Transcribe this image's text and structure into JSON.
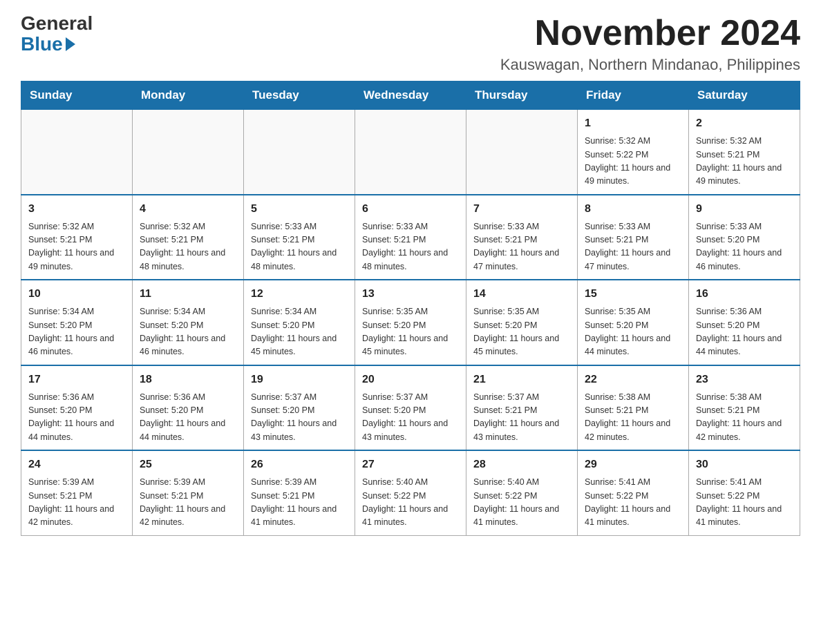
{
  "header": {
    "logo_general": "General",
    "logo_blue": "Blue",
    "month_title": "November 2024",
    "location": "Kauswagan, Northern Mindanao, Philippines"
  },
  "weekdays": [
    "Sunday",
    "Monday",
    "Tuesday",
    "Wednesday",
    "Thursday",
    "Friday",
    "Saturday"
  ],
  "weeks": [
    [
      {
        "day": "",
        "info": ""
      },
      {
        "day": "",
        "info": ""
      },
      {
        "day": "",
        "info": ""
      },
      {
        "day": "",
        "info": ""
      },
      {
        "day": "",
        "info": ""
      },
      {
        "day": "1",
        "info": "Sunrise: 5:32 AM\nSunset: 5:22 PM\nDaylight: 11 hours and 49 minutes."
      },
      {
        "day": "2",
        "info": "Sunrise: 5:32 AM\nSunset: 5:21 PM\nDaylight: 11 hours and 49 minutes."
      }
    ],
    [
      {
        "day": "3",
        "info": "Sunrise: 5:32 AM\nSunset: 5:21 PM\nDaylight: 11 hours and 49 minutes."
      },
      {
        "day": "4",
        "info": "Sunrise: 5:32 AM\nSunset: 5:21 PM\nDaylight: 11 hours and 48 minutes."
      },
      {
        "day": "5",
        "info": "Sunrise: 5:33 AM\nSunset: 5:21 PM\nDaylight: 11 hours and 48 minutes."
      },
      {
        "day": "6",
        "info": "Sunrise: 5:33 AM\nSunset: 5:21 PM\nDaylight: 11 hours and 48 minutes."
      },
      {
        "day": "7",
        "info": "Sunrise: 5:33 AM\nSunset: 5:21 PM\nDaylight: 11 hours and 47 minutes."
      },
      {
        "day": "8",
        "info": "Sunrise: 5:33 AM\nSunset: 5:21 PM\nDaylight: 11 hours and 47 minutes."
      },
      {
        "day": "9",
        "info": "Sunrise: 5:33 AM\nSunset: 5:20 PM\nDaylight: 11 hours and 46 minutes."
      }
    ],
    [
      {
        "day": "10",
        "info": "Sunrise: 5:34 AM\nSunset: 5:20 PM\nDaylight: 11 hours and 46 minutes."
      },
      {
        "day": "11",
        "info": "Sunrise: 5:34 AM\nSunset: 5:20 PM\nDaylight: 11 hours and 46 minutes."
      },
      {
        "day": "12",
        "info": "Sunrise: 5:34 AM\nSunset: 5:20 PM\nDaylight: 11 hours and 45 minutes."
      },
      {
        "day": "13",
        "info": "Sunrise: 5:35 AM\nSunset: 5:20 PM\nDaylight: 11 hours and 45 minutes."
      },
      {
        "day": "14",
        "info": "Sunrise: 5:35 AM\nSunset: 5:20 PM\nDaylight: 11 hours and 45 minutes."
      },
      {
        "day": "15",
        "info": "Sunrise: 5:35 AM\nSunset: 5:20 PM\nDaylight: 11 hours and 44 minutes."
      },
      {
        "day": "16",
        "info": "Sunrise: 5:36 AM\nSunset: 5:20 PM\nDaylight: 11 hours and 44 minutes."
      }
    ],
    [
      {
        "day": "17",
        "info": "Sunrise: 5:36 AM\nSunset: 5:20 PM\nDaylight: 11 hours and 44 minutes."
      },
      {
        "day": "18",
        "info": "Sunrise: 5:36 AM\nSunset: 5:20 PM\nDaylight: 11 hours and 44 minutes."
      },
      {
        "day": "19",
        "info": "Sunrise: 5:37 AM\nSunset: 5:20 PM\nDaylight: 11 hours and 43 minutes."
      },
      {
        "day": "20",
        "info": "Sunrise: 5:37 AM\nSunset: 5:20 PM\nDaylight: 11 hours and 43 minutes."
      },
      {
        "day": "21",
        "info": "Sunrise: 5:37 AM\nSunset: 5:21 PM\nDaylight: 11 hours and 43 minutes."
      },
      {
        "day": "22",
        "info": "Sunrise: 5:38 AM\nSunset: 5:21 PM\nDaylight: 11 hours and 42 minutes."
      },
      {
        "day": "23",
        "info": "Sunrise: 5:38 AM\nSunset: 5:21 PM\nDaylight: 11 hours and 42 minutes."
      }
    ],
    [
      {
        "day": "24",
        "info": "Sunrise: 5:39 AM\nSunset: 5:21 PM\nDaylight: 11 hours and 42 minutes."
      },
      {
        "day": "25",
        "info": "Sunrise: 5:39 AM\nSunset: 5:21 PM\nDaylight: 11 hours and 42 minutes."
      },
      {
        "day": "26",
        "info": "Sunrise: 5:39 AM\nSunset: 5:21 PM\nDaylight: 11 hours and 41 minutes."
      },
      {
        "day": "27",
        "info": "Sunrise: 5:40 AM\nSunset: 5:22 PM\nDaylight: 11 hours and 41 minutes."
      },
      {
        "day": "28",
        "info": "Sunrise: 5:40 AM\nSunset: 5:22 PM\nDaylight: 11 hours and 41 minutes."
      },
      {
        "day": "29",
        "info": "Sunrise: 5:41 AM\nSunset: 5:22 PM\nDaylight: 11 hours and 41 minutes."
      },
      {
        "day": "30",
        "info": "Sunrise: 5:41 AM\nSunset: 5:22 PM\nDaylight: 11 hours and 41 minutes."
      }
    ]
  ]
}
